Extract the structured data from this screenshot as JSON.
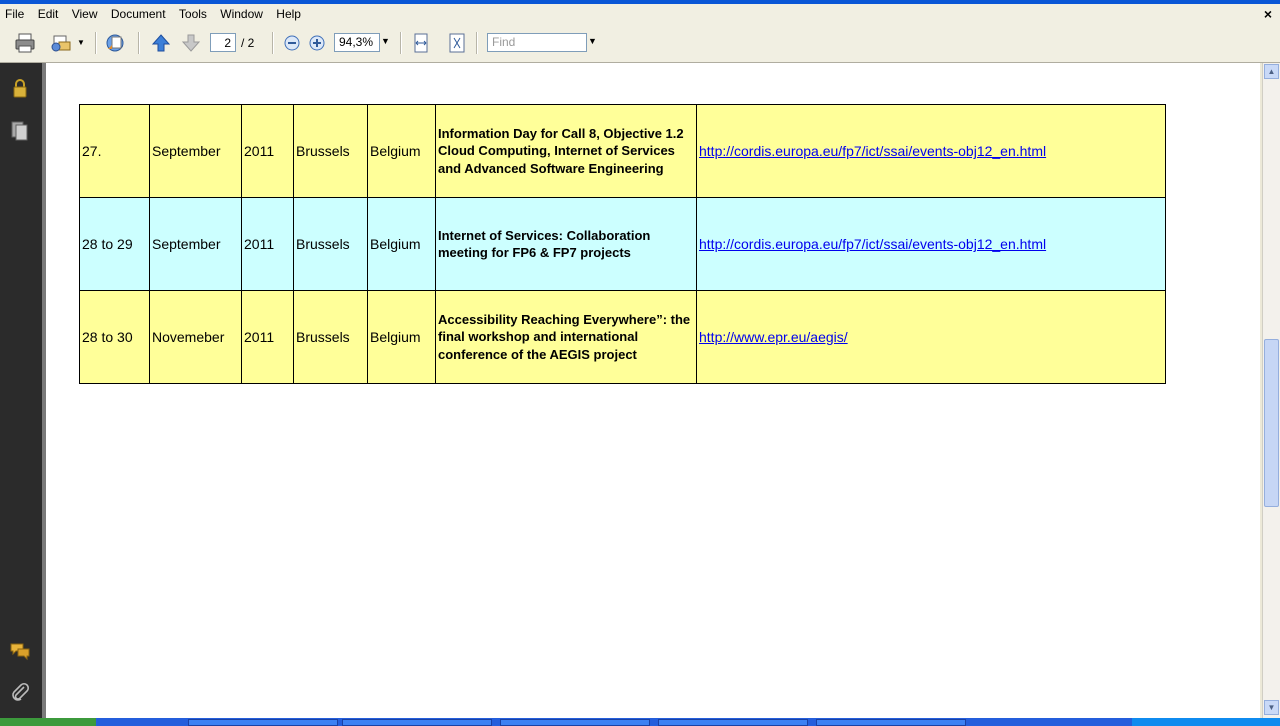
{
  "menu": [
    "File",
    "Edit",
    "View",
    "Document",
    "Tools",
    "Window",
    "Help"
  ],
  "menu_close": "×",
  "toolbar": {
    "current_page": "2",
    "page_total": "/ 2",
    "zoom": "94,3%",
    "find_placeholder": "Find"
  },
  "table": {
    "rows": [
      {
        "style": "yellow",
        "day": "27.",
        "month": "September",
        "year": "2011",
        "city": "Brussels",
        "country": "Belgium",
        "title": "Information Day for Call 8, Objective 1.2 Cloud Computing, Internet of Services and Advanced Software Engineering",
        "url": "http://cordis.europa.eu/fp7/ict/ssai/events-obj12_en.html"
      },
      {
        "style": "cyan",
        "day": "28 to 29",
        "month": "September",
        "year": "2011",
        "city": "Brussels",
        "country": "Belgium",
        "title": "Internet of Services: Collaboration meeting for FP6 & FP7 projects",
        "url": "http://cordis.europa.eu/fp7/ict/ssai/events-obj12_en.html"
      },
      {
        "style": "yellow",
        "day": "28 to 30",
        "month": "Novemeber",
        "year": "2011",
        "city": "Brussels",
        "country": "Belgium",
        "title": "Accessibility Reaching Everywhere”: the final workshop and international conference of the AEGIS project",
        "url": "http://www.epr.eu/aegis/"
      }
    ]
  },
  "colors": {
    "row_yellow": "#FFFF99",
    "row_cyan": "#CCFFFF",
    "link": "#0000EE",
    "sidebar": "#2B2B2B"
  },
  "icons": {
    "sidebar": [
      "lock-icon",
      "pages-icon",
      "comments-icon",
      "attachments-icon"
    ],
    "toolbar": [
      "print-icon",
      "email-icon",
      "collaborate-icon",
      "previous-page-icon",
      "next-page-icon",
      "zoom-out-icon",
      "zoom-in-icon",
      "fit-width-icon",
      "fit-page-icon"
    ]
  }
}
